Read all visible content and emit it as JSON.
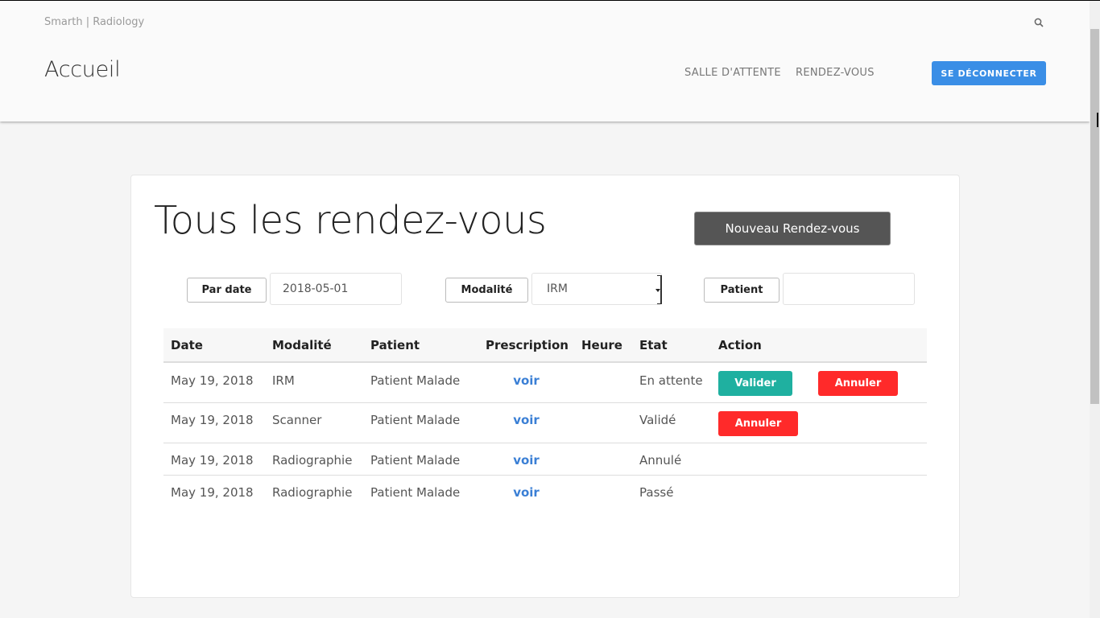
{
  "header": {
    "brand": "Smarth | Radiology",
    "page_title": "Accueil",
    "nav": [
      "SALLE D'ATTENTE",
      "RENDEZ-VOUS"
    ],
    "logout_label": "SE DÉCONNECTER"
  },
  "main": {
    "title": "Tous les rendez-vous",
    "new_button": "Nouveau Rendez-vous",
    "filters": {
      "date_label": "Par date",
      "date_value": "2018-05-01",
      "modality_label": "Modalité",
      "modality_value": "IRM",
      "patient_label": "Patient",
      "patient_value": ""
    },
    "table": {
      "headers": [
        "Date",
        "Modalité",
        "Patient",
        "Prescription",
        "Heure",
        "Etat",
        "Action"
      ],
      "rows": [
        {
          "date": "May 19, 2018",
          "modality": "IRM",
          "patient": "Patient Malade",
          "prescription": "voir",
          "heure": "",
          "etat": "En attente",
          "actions": [
            "Valider",
            "Annuler"
          ]
        },
        {
          "date": "May 19, 2018",
          "modality": "Scanner",
          "patient": "Patient Malade",
          "prescription": "voir",
          "heure": "",
          "etat": "Validé",
          "actions": [
            "Annuler"
          ]
        },
        {
          "date": "May 19, 2018",
          "modality": "Radiographie",
          "patient": "Patient Malade",
          "prescription": "voir",
          "heure": "",
          "etat": "Annulé",
          "actions": []
        },
        {
          "date": "May 19, 2018",
          "modality": "Radiographie",
          "patient": "Patient Malade",
          "prescription": "voir",
          "heure": "",
          "etat": "Passé",
          "actions": []
        }
      ]
    }
  },
  "colors": {
    "primary": "#3a8ee6",
    "valider": "#1fb0a0",
    "annuler": "#ff2a2a",
    "link": "#3a7fd5"
  },
  "icons": {
    "search": "search-icon"
  }
}
